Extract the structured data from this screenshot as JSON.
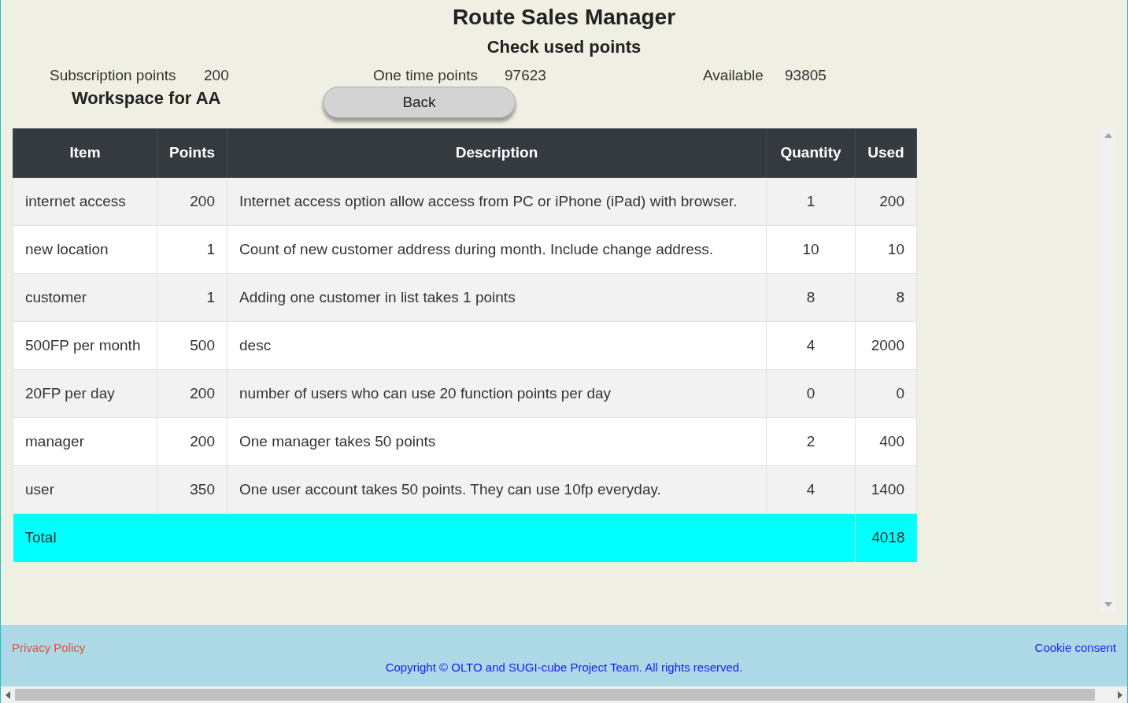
{
  "title": "Route Sales Manager",
  "subtitle": "Check used points",
  "stats": [
    {
      "label": "Subscription points",
      "value": "200"
    },
    {
      "label": "One time points",
      "value": "97623"
    },
    {
      "label": "Available",
      "value": "93805"
    }
  ],
  "workspace": "Workspace for AA",
  "back_button": "Back",
  "table": {
    "columns": [
      "Item",
      "Points",
      "Description",
      "Quantity",
      "Used"
    ],
    "rows": [
      {
        "item": "internet access",
        "points": "200",
        "description": "Internet access option allow access from PC or iPhone (iPad) with browser.",
        "quantity": "1",
        "used": "200"
      },
      {
        "item": "new location",
        "points": "1",
        "description": "Count of new customer address during month. Include change address.",
        "quantity": "10",
        "used": "10"
      },
      {
        "item": "customer",
        "points": "1",
        "description": "Adding one customer in list takes 1 points",
        "quantity": "8",
        "used": "8"
      },
      {
        "item": "500FP per month",
        "points": "500",
        "description": "desc",
        "quantity": "4",
        "used": "2000"
      },
      {
        "item": "20FP per day",
        "points": "200",
        "description": "number of users who can use 20 function points per day",
        "quantity": "0",
        "used": "0"
      },
      {
        "item": "manager",
        "points": "200",
        "description": "One manager takes 50 points",
        "quantity": "2",
        "used": "400"
      },
      {
        "item": "user",
        "points": "350",
        "description": "One user account takes 50 points. They can use 10fp everyday.",
        "quantity": "4",
        "used": "1400"
      }
    ],
    "total": {
      "label": "Total",
      "value": "4018"
    }
  },
  "footer": {
    "privacy_link": "Privacy Policy",
    "cookie_link": "Cookie consent",
    "copyright": "Copyright © OLTO and SUGI-cube Project Team. All rights reserved."
  }
}
